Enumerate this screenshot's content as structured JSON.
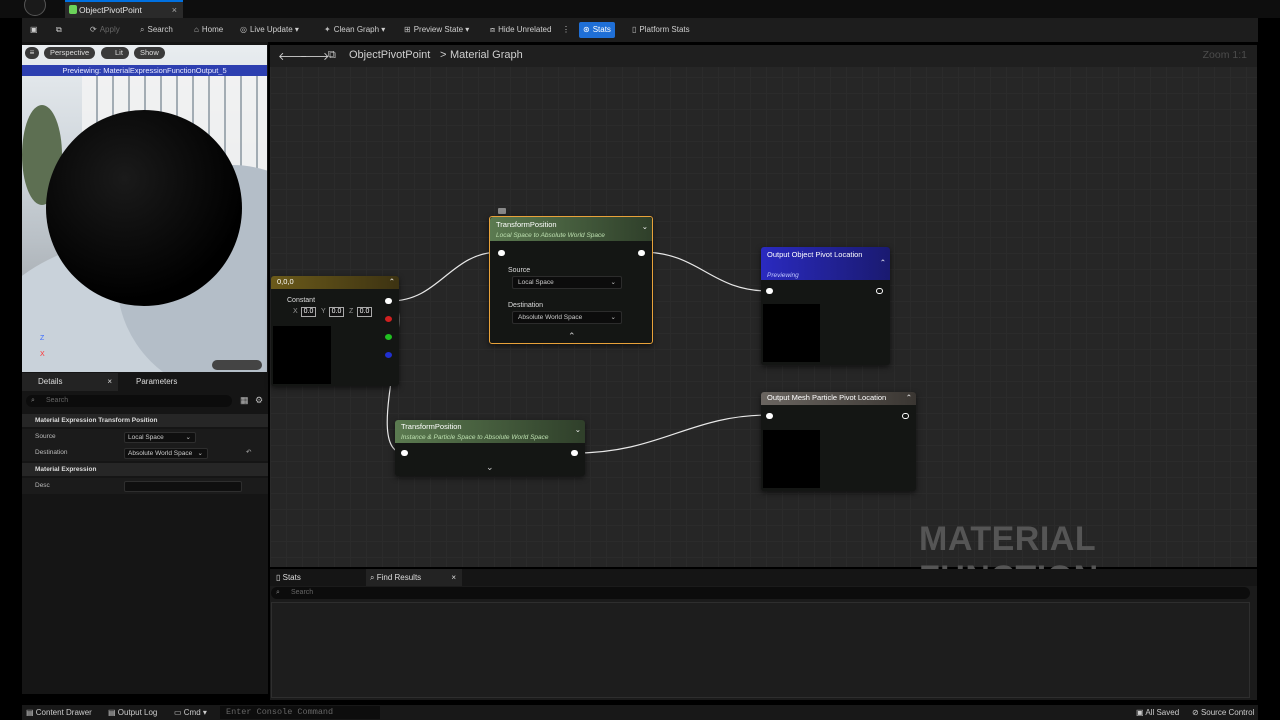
{
  "window": {
    "tab_title": "ObjectPivotPoint",
    "tab_close": "×"
  },
  "toolbar": {
    "apply": "Apply",
    "search": "Search",
    "home": "Home",
    "live_update": "Live Update",
    "clean_graph": "Clean Graph",
    "preview_state": "Preview State",
    "hide_unrelated": "Hide Unrelated",
    "stats": "Stats",
    "platform_stats": "Platform Stats"
  },
  "viewport": {
    "mode_perspective": "Perspective",
    "mode_lit": "Lit",
    "mode_show": "Show",
    "previewing": "Previewing: MaterialExpressionFunctionOutput_5",
    "axis_z": "Z",
    "axis_x": "X"
  },
  "details": {
    "tab_details": "Details",
    "tab_parameters": "Parameters",
    "tab_close": "×",
    "search_placeholder": "Search",
    "section1": "Material Expression Transform Position",
    "source_label": "Source",
    "source_value": "Local Space",
    "destination_label": "Destination",
    "destination_value": "Absolute World Space",
    "section2": "Material Expression",
    "desc_label": "Desc",
    "desc_value": ""
  },
  "graph": {
    "breadcrumb_asset": "ObjectPivotPoint",
    "breadcrumb_sep": ">",
    "breadcrumb_graph": "Material Graph",
    "zoom": "Zoom 1:1",
    "watermark": "MATERIAL FUNCTION",
    "nodes": {
      "constant": {
        "title": "0,0,0",
        "label": "Constant",
        "x_label": "X",
        "x": "0.0",
        "y_label": "Y",
        "y": "0.0",
        "z_label": "Z",
        "z": "0.0"
      },
      "transform1": {
        "title": "TransformPosition",
        "subtitle": "Local Space to Absolute World Space",
        "source_label": "Source",
        "source": "Local Space",
        "destination_label": "Destination",
        "destination": "Absolute World Space"
      },
      "transform2": {
        "title": "TransformPosition",
        "subtitle": "Instance & Particle Space to Absolute World Space"
      },
      "output1": {
        "title": "Output Object Pivot Location",
        "subtitle": "Previewing"
      },
      "output2": {
        "title": "Output Mesh Particle Pivot Location"
      }
    }
  },
  "bottom": {
    "tab_stats": "Stats",
    "tab_find": "Find Results",
    "tab_close": "×",
    "search_placeholder": "Search"
  },
  "statusbar": {
    "content_drawer": "Content Drawer",
    "output_log": "Output Log",
    "cmd": "Cmd",
    "console_placeholder": "Enter Console Command",
    "all_saved": "All Saved",
    "source_control": "Source Control"
  },
  "colors": {
    "accent": "#1f6fd6",
    "selection": "#e8a23a",
    "node_green": "#4e6b44",
    "node_blue": "#2020a0",
    "node_gold": "#6b5a1a"
  }
}
